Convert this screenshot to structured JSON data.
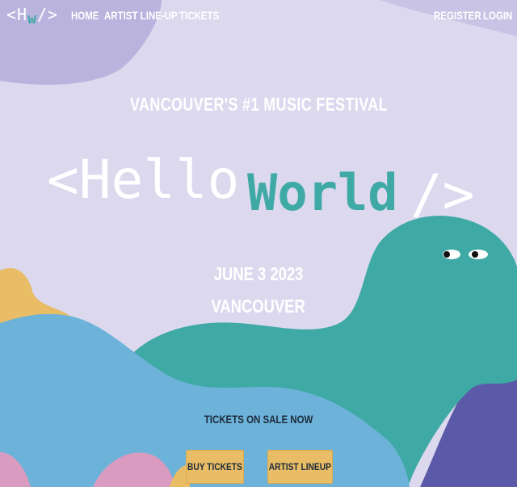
{
  "nav": {
    "logo_left": "<H",
    "logo_mid": "w",
    "logo_right": "/>",
    "links": [
      "HOME",
      "ARTIST LINE-UP",
      "TICKETS"
    ],
    "register": "REGISTER",
    "login": "LOGIN"
  },
  "hero": {
    "tagline": "VANCOUVER'S #1 MUSIC FESTIVAL",
    "title_open": "<Hello",
    "title_world": "World",
    "title_close": "/>",
    "date": "JUNE 3 2023",
    "city": "VANCOUVER",
    "sale": "TICKETS ON SALE NOW",
    "buy_button": "BUY TICKETS",
    "lineup_button": "ARTIST LINEUP"
  },
  "colors": {
    "background": "#dcd9ef",
    "teal": "#3fa9a5",
    "blue": "#6db3d9",
    "yellow": "#e9bd66",
    "pink": "#d99bc0",
    "navy": "#5a5aa8",
    "lavender": "#b9b3de"
  }
}
